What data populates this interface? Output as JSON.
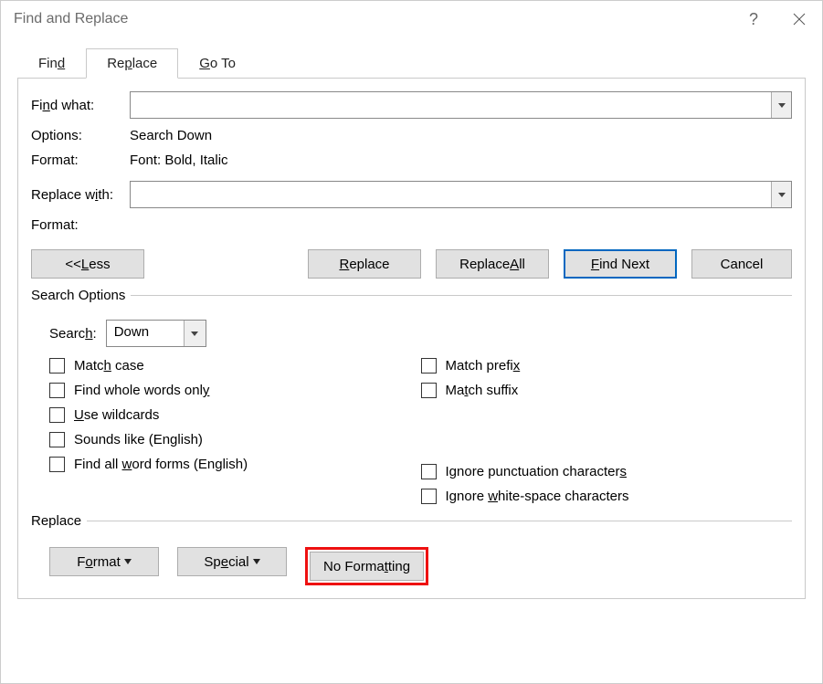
{
  "window": {
    "title": "Find and Replace"
  },
  "tabs": {
    "find": "Find",
    "replace": "Replace",
    "goto": "Go To"
  },
  "labels": {
    "find_what": "Find what:",
    "options": "Options:",
    "format": "Format:",
    "replace_with": "Replace with:",
    "format2": "Format:",
    "search": "Search:",
    "search_options_legend": "Search Options",
    "replace_legend": "Replace"
  },
  "values": {
    "find_what": "",
    "options": "Search Down",
    "find_format": "Font: Bold, Italic",
    "replace_with": "",
    "replace_format": "",
    "search_direction": "Down"
  },
  "buttons": {
    "less": "<< Less",
    "replace": "Replace",
    "replace_all": "Replace All",
    "find_next": "Find Next",
    "cancel": "Cancel",
    "format": "Format",
    "special": "Special",
    "no_formatting": "No Formatting"
  },
  "checkboxes": {
    "match_case": "Match case",
    "whole_words": "Find whole words only",
    "wildcards": "Use wildcards",
    "sounds_like": "Sounds like (English)",
    "word_forms": "Find all word forms (English)",
    "match_prefix": "Match prefix",
    "match_suffix": "Match suffix",
    "ignore_punct": "Ignore punctuation characters",
    "ignore_ws": "Ignore white-space characters"
  }
}
